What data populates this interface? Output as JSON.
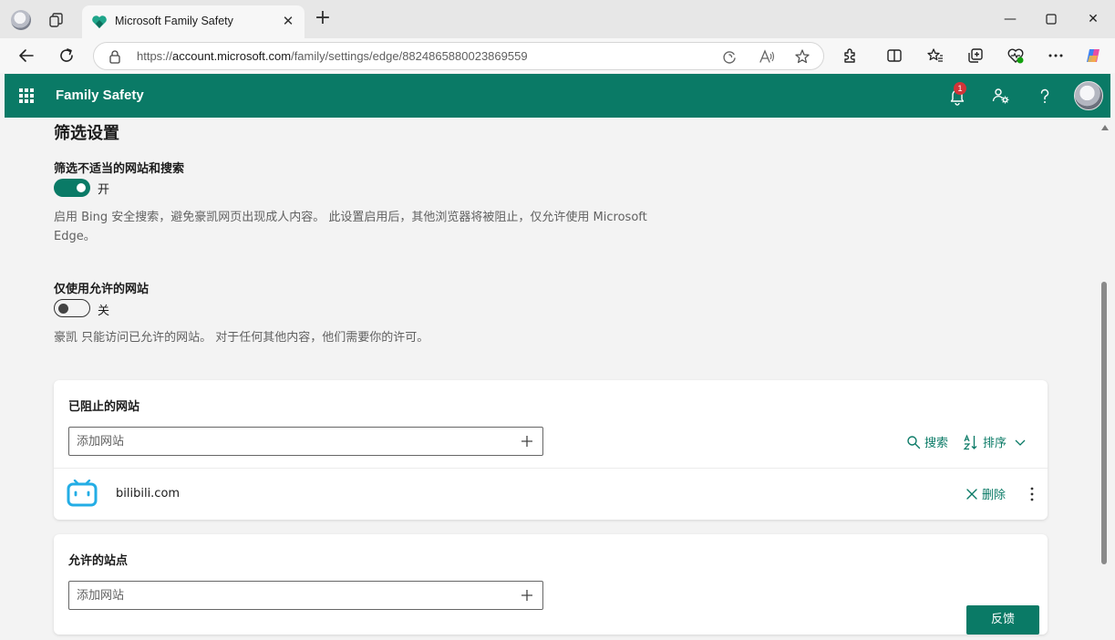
{
  "browser": {
    "tab_title": "Microsoft Family Safety",
    "url_prefix": "https://",
    "url_host": "account.microsoft.com",
    "url_path": "/family/settings/edge/8824865880023869559"
  },
  "app": {
    "title": "Family Safety",
    "notification_count": "1"
  },
  "filter": {
    "section_title": "筛选设置",
    "inappropriate": {
      "label": "筛选不适当的网站和搜索",
      "state_text": "开",
      "on": true,
      "desc_line1": "启用 Bing 安全搜索，避免豪凯网页出现成人内容。 此设置启用后，其他浏览器将被阻止，仅允许使用 Microsoft",
      "desc_line2": "Edge。"
    },
    "allowed_only": {
      "label": "仅使用允许的网站",
      "state_text": "关",
      "on": false,
      "desc": "豪凯 只能访问已允许的网站。 对于任何其他内容，他们需要你的许可。"
    }
  },
  "blocked": {
    "title": "已阻止的网站",
    "input_placeholder": "添加网站",
    "search_label": "搜索",
    "sort_label": "排序",
    "items": [
      {
        "name": "bilibili.com",
        "delete_label": "删除"
      }
    ]
  },
  "allowed": {
    "title": "允许的站点",
    "input_placeholder": "添加网站"
  },
  "feedback_label": "反馈",
  "colors": {
    "brand": "#0a7a66",
    "badge": "#d13438",
    "bilibili": "#23ade5"
  }
}
